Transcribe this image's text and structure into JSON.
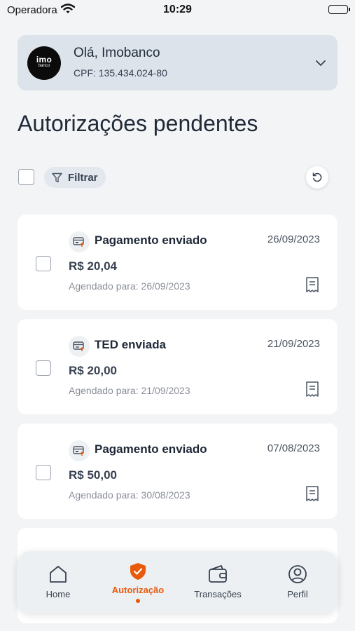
{
  "status_bar": {
    "carrier": "Operadora",
    "time": "10:29"
  },
  "account": {
    "logo_line1": "imo",
    "logo_line2": "banco",
    "greeting": "Olá, Imobanco",
    "cpf": "CPF: 135.434.024-80"
  },
  "page": {
    "title": "Autorizações pendentes"
  },
  "toolbar": {
    "filter_label": "Filtrar"
  },
  "transactions": [
    {
      "title": "Pagamento enviado",
      "date": "26/09/2023",
      "amount": "R$ 20,04",
      "scheduled": "Agendado para: 26/09/2023",
      "icon": "payment-sent-icon"
    },
    {
      "title": "TED enviada",
      "date": "21/09/2023",
      "amount": "R$ 20,00",
      "scheduled": "Agendado para: 21/09/2023",
      "icon": "transfer-sent-icon"
    },
    {
      "title": "Pagamento enviado",
      "date": "07/08/2023",
      "amount": "R$ 50,00",
      "scheduled": "Agendado para: 30/08/2023",
      "icon": "payment-sent-icon"
    }
  ],
  "bottom_nav": {
    "items": [
      {
        "label": "Home",
        "icon": "home-icon"
      },
      {
        "label": "Autorização",
        "icon": "shield-check-icon",
        "active": true
      },
      {
        "label": "Transações",
        "icon": "wallet-icon"
      },
      {
        "label": "Perfil",
        "icon": "user-icon"
      }
    ]
  },
  "colors": {
    "accent": "#e8590c",
    "card_bg": "#ffffff",
    "page_bg": "#f3f4f6",
    "header_bg": "#dde3ea"
  }
}
